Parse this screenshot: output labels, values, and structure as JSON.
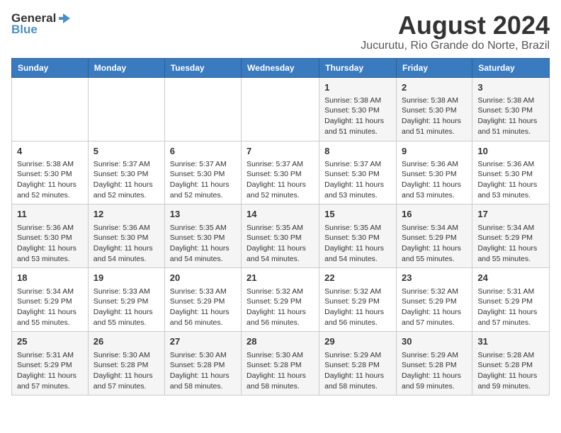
{
  "logo": {
    "text1": "General",
    "text2": "Blue"
  },
  "title": "August 2024",
  "subtitle": "Jucurutu, Rio Grande do Norte, Brazil",
  "days_of_week": [
    "Sunday",
    "Monday",
    "Tuesday",
    "Wednesday",
    "Thursday",
    "Friday",
    "Saturday"
  ],
  "weeks": [
    [
      {
        "day": "",
        "info": ""
      },
      {
        "day": "",
        "info": ""
      },
      {
        "day": "",
        "info": ""
      },
      {
        "day": "",
        "info": ""
      },
      {
        "day": "1",
        "info": "Sunrise: 5:38 AM\nSunset: 5:30 PM\nDaylight: 11 hours and 51 minutes."
      },
      {
        "day": "2",
        "info": "Sunrise: 5:38 AM\nSunset: 5:30 PM\nDaylight: 11 hours and 51 minutes."
      },
      {
        "day": "3",
        "info": "Sunrise: 5:38 AM\nSunset: 5:30 PM\nDaylight: 11 hours and 51 minutes."
      }
    ],
    [
      {
        "day": "4",
        "info": "Sunrise: 5:38 AM\nSunset: 5:30 PM\nDaylight: 11 hours and 52 minutes."
      },
      {
        "day": "5",
        "info": "Sunrise: 5:37 AM\nSunset: 5:30 PM\nDaylight: 11 hours and 52 minutes."
      },
      {
        "day": "6",
        "info": "Sunrise: 5:37 AM\nSunset: 5:30 PM\nDaylight: 11 hours and 52 minutes."
      },
      {
        "day": "7",
        "info": "Sunrise: 5:37 AM\nSunset: 5:30 PM\nDaylight: 11 hours and 52 minutes."
      },
      {
        "day": "8",
        "info": "Sunrise: 5:37 AM\nSunset: 5:30 PM\nDaylight: 11 hours and 53 minutes."
      },
      {
        "day": "9",
        "info": "Sunrise: 5:36 AM\nSunset: 5:30 PM\nDaylight: 11 hours and 53 minutes."
      },
      {
        "day": "10",
        "info": "Sunrise: 5:36 AM\nSunset: 5:30 PM\nDaylight: 11 hours and 53 minutes."
      }
    ],
    [
      {
        "day": "11",
        "info": "Sunrise: 5:36 AM\nSunset: 5:30 PM\nDaylight: 11 hours and 53 minutes."
      },
      {
        "day": "12",
        "info": "Sunrise: 5:36 AM\nSunset: 5:30 PM\nDaylight: 11 hours and 54 minutes."
      },
      {
        "day": "13",
        "info": "Sunrise: 5:35 AM\nSunset: 5:30 PM\nDaylight: 11 hours and 54 minutes."
      },
      {
        "day": "14",
        "info": "Sunrise: 5:35 AM\nSunset: 5:30 PM\nDaylight: 11 hours and 54 minutes."
      },
      {
        "day": "15",
        "info": "Sunrise: 5:35 AM\nSunset: 5:30 PM\nDaylight: 11 hours and 54 minutes."
      },
      {
        "day": "16",
        "info": "Sunrise: 5:34 AM\nSunset: 5:29 PM\nDaylight: 11 hours and 55 minutes."
      },
      {
        "day": "17",
        "info": "Sunrise: 5:34 AM\nSunset: 5:29 PM\nDaylight: 11 hours and 55 minutes."
      }
    ],
    [
      {
        "day": "18",
        "info": "Sunrise: 5:34 AM\nSunset: 5:29 PM\nDaylight: 11 hours and 55 minutes."
      },
      {
        "day": "19",
        "info": "Sunrise: 5:33 AM\nSunset: 5:29 PM\nDaylight: 11 hours and 55 minutes."
      },
      {
        "day": "20",
        "info": "Sunrise: 5:33 AM\nSunset: 5:29 PM\nDaylight: 11 hours and 56 minutes."
      },
      {
        "day": "21",
        "info": "Sunrise: 5:32 AM\nSunset: 5:29 PM\nDaylight: 11 hours and 56 minutes."
      },
      {
        "day": "22",
        "info": "Sunrise: 5:32 AM\nSunset: 5:29 PM\nDaylight: 11 hours and 56 minutes."
      },
      {
        "day": "23",
        "info": "Sunrise: 5:32 AM\nSunset: 5:29 PM\nDaylight: 11 hours and 57 minutes."
      },
      {
        "day": "24",
        "info": "Sunrise: 5:31 AM\nSunset: 5:29 PM\nDaylight: 11 hours and 57 minutes."
      }
    ],
    [
      {
        "day": "25",
        "info": "Sunrise: 5:31 AM\nSunset: 5:29 PM\nDaylight: 11 hours and 57 minutes."
      },
      {
        "day": "26",
        "info": "Sunrise: 5:30 AM\nSunset: 5:28 PM\nDaylight: 11 hours and 57 minutes."
      },
      {
        "day": "27",
        "info": "Sunrise: 5:30 AM\nSunset: 5:28 PM\nDaylight: 11 hours and 58 minutes."
      },
      {
        "day": "28",
        "info": "Sunrise: 5:30 AM\nSunset: 5:28 PM\nDaylight: 11 hours and 58 minutes."
      },
      {
        "day": "29",
        "info": "Sunrise: 5:29 AM\nSunset: 5:28 PM\nDaylight: 11 hours and 58 minutes."
      },
      {
        "day": "30",
        "info": "Sunrise: 5:29 AM\nSunset: 5:28 PM\nDaylight: 11 hours and 59 minutes."
      },
      {
        "day": "31",
        "info": "Sunrise: 5:28 AM\nSunset: 5:28 PM\nDaylight: 11 hours and 59 minutes."
      }
    ]
  ]
}
